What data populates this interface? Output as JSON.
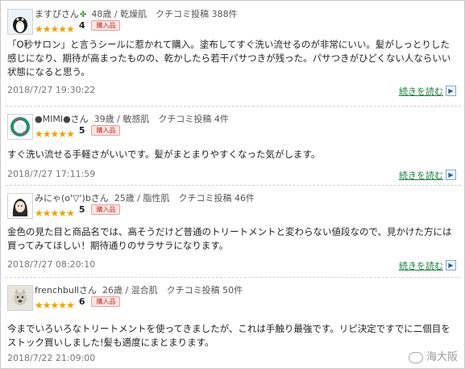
{
  "reviews": [
    {
      "user": "ますぴさん",
      "leaf": "✤",
      "meta": "48歳 / 乾燥肌　クチコミ投稿 388件",
      "rating": "4",
      "badge": "購入品",
      "text": "「O秒サロン」と言うシールに惹かれて購入。塗布してすぐ洗い流せるのが非常にいい。髪がしっとりした感じになり、期待が高まったものの、乾かしたら若干パサつきが残った。パサつきがひどくない人ならいい状態になると思う。",
      "date": "2018/7/27 19:30:22",
      "more": "続きを読む"
    },
    {
      "user": "●MIMI●さん",
      "meta": "39歳 / 敏感肌　クチコミ投稿 4件",
      "rating": "5",
      "badge": "購入品",
      "text": "すぐ洗い流せる手軽さがいいです。髪がまとまりやすくなった気がします。",
      "date": "2018/7/27 17:11:59",
      "more": "続きを読む"
    },
    {
      "user": "みにゃ(o'▽')bさん",
      "meta": "25歳 / 脂性肌　クチコミ投稿 46件",
      "rating": "5",
      "badge": "購入品",
      "text": "金色の見た目と商品名では、高そうだけど普通のトリートメントと変わらない値段なので、見かけた方には買ってみてほしい！期待通りのサラサラになります。",
      "date": "2018/7/27 08:20:10",
      "more": "続きを読む"
    },
    {
      "user": "frenchbullさん",
      "meta": "26歳 / 混合肌　クチコミ投稿 50件",
      "rating": "6",
      "badge": "購入品",
      "text": "今までいろいろなトリートメントを使ってきましたが、これは手触り最強です。リピ決定ですでに二個目をストック買いしました!髪も適度にまとまります。",
      "date": "2018/7/22 21:09:00",
      "more": ""
    }
  ],
  "watermark": "海大阪",
  "colors": {
    "star": "#f2a100",
    "link": "#1a7f3c",
    "badge_text": "#c0392b",
    "leaf": "#3aa02a"
  }
}
